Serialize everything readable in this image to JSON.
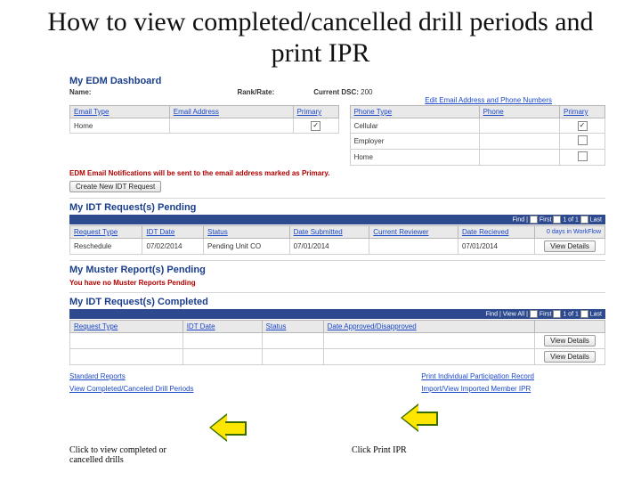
{
  "slide": {
    "title": "How to view completed/cancelled drill periods and print IPR"
  },
  "dashboard": {
    "heading": "My EDM Dashboard",
    "labels": {
      "name": "Name:",
      "rank": "Rank/Rate:",
      "dsc": "Current DSC:",
      "dsc_value": "200",
      "edit_link": "Edit Email Address and Phone Numbers"
    },
    "email_table": {
      "headers": [
        "Email Type",
        "Email Address",
        "Primary"
      ],
      "rows": [
        {
          "type": "Home",
          "address": "",
          "primary": true
        }
      ]
    },
    "phone_table": {
      "headers": [
        "Phone Type",
        "Phone",
        "Primary"
      ],
      "rows": [
        {
          "type": "Cellular",
          "phone": "",
          "primary": true
        },
        {
          "type": "Employer",
          "phone": "",
          "primary": false
        },
        {
          "type": "Home",
          "phone": "",
          "primary": false
        }
      ]
    },
    "primary_note": "EDM Email Notifications will be sent to the email address marked as Primary.",
    "create_btn": "Create New IDT Request"
  },
  "pending": {
    "heading": "My IDT Request(s) Pending",
    "findbar": {
      "find": "Find |",
      "first": "First",
      "count": "1 of 1",
      "last": "Last"
    },
    "headers": [
      "Request Type",
      "IDT Date",
      "Status",
      "Date Submitted",
      "Current Reviewer",
      "Date Recieved",
      ""
    ],
    "row": {
      "request_type": "Reschedule",
      "idt_date": "07/02/2014",
      "status": "Pending Unit CO",
      "date_submitted": "07/01/2014",
      "current_reviewer": "",
      "date_recieved": "07/01/2014",
      "workflow": "0 days in WorkFlow",
      "details_btn": "View Details"
    }
  },
  "muster": {
    "heading": "My Muster Report(s) Pending",
    "note": "You have no Muster Reports Pending"
  },
  "completed": {
    "heading": "My IDT Request(s) Completed",
    "findbar": {
      "find": "Find | View All |",
      "first": "First",
      "count": "1 of 1",
      "last": "Last"
    },
    "headers": [
      "Request Type",
      "IDT Date",
      "Status",
      "Date Approved/Disapproved",
      ""
    ],
    "rows": [
      {
        "details_btn": "View Details"
      },
      {
        "details_btn": "View Details"
      }
    ]
  },
  "bottom_links": {
    "left": [
      "Standard Reports",
      "View Completed/Canceled Drill Periods"
    ],
    "right": [
      "Print Individual Participation Record",
      "Import/View Imported Member IPR"
    ]
  },
  "captions": {
    "c1": "Click to view completed or cancelled drills",
    "c2": "Click Print IPR"
  }
}
